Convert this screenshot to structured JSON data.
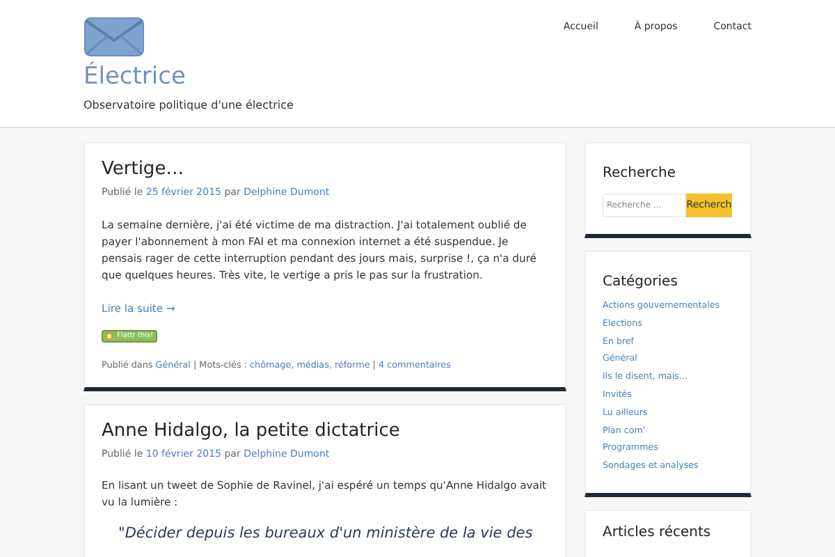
{
  "site": {
    "title": "Électrice",
    "tagline": "Observatoire politique d'une électrice"
  },
  "nav": [
    {
      "label": "Accueil"
    },
    {
      "label": "À propos"
    },
    {
      "label": "Contact"
    }
  ],
  "posts": [
    {
      "title": "Vertige…",
      "meta_prefix": "Publié le",
      "date": "25 février 2015",
      "meta_by": "par",
      "author": "Delphine Dumont",
      "paragraphs": [
        "La semaine dernière, j'ai été victime de ma distraction. J'ai totalement oublié de payer l'abonnement à mon FAI et ma connexion internet a été suspendue. Je pensais rager de cette interruption pendant des jours mais, surprise !, ça n'a duré que quelques heures. Très vite, le vertige a pris le pas sur la frustration."
      ],
      "read_more": "Lire la suite →",
      "flattr": "Flattr this!",
      "footer": {
        "category_prefix": "Publié dans",
        "category": "Général",
        "tags_prefix": "| Mots-clés :",
        "tags": "chômage, médias, réforme",
        "separator": "|",
        "comments": "4 commentaires"
      }
    },
    {
      "title": "Anne Hidalgo, la petite dictatrice",
      "meta_prefix": "Publié le",
      "date": "10 février 2015",
      "meta_by": "par",
      "author": "Delphine Dumont",
      "paragraphs": [
        "En lisant un tweet de Sophie de Ravinel, j'ai espéré un temps qu'Anne Hidalgo avait vu la lumière :"
      ],
      "quote": "\"Décider depuis les bureaux d'un ministère de la vie des"
    }
  ],
  "sidebar": {
    "search": {
      "title": "Recherche",
      "placeholder": "Recherche …",
      "button": "Recherch"
    },
    "categories": {
      "title": "Catégories",
      "items": [
        "Actions gouvernementales",
        "Elections",
        "En bref",
        "Général",
        "Ils le disent, mais…",
        "Invités",
        "Lu ailleurs",
        "Plan com'",
        "Programmes",
        "Sondages et analyses"
      ]
    },
    "recent": {
      "title": "Articles récents"
    }
  }
}
